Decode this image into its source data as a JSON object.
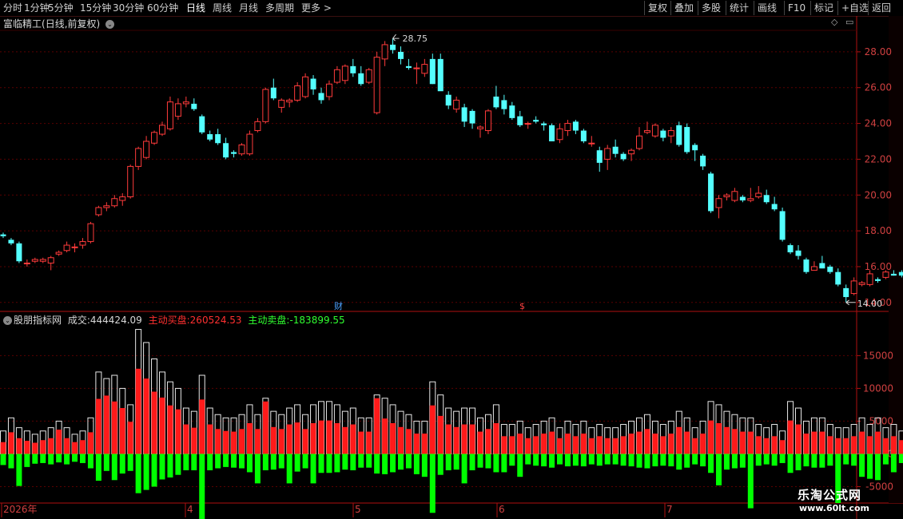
{
  "toolbar": {
    "left_items": [
      {
        "name": "toolbar-fenshi",
        "label": "分时"
      },
      {
        "name": "toolbar-1min",
        "label": "1分钟"
      },
      {
        "name": "toolbar-5min",
        "label": "5分钟"
      },
      {
        "name": "toolbar-15min",
        "label": "15分钟"
      },
      {
        "name": "toolbar-30min",
        "label": "30分钟"
      },
      {
        "name": "toolbar-60min",
        "label": "60分钟"
      },
      {
        "name": "toolbar-daily",
        "label": "日线",
        "active": true
      },
      {
        "name": "toolbar-weekly",
        "label": "周线"
      },
      {
        "name": "toolbar-monthly",
        "label": "月线"
      },
      {
        "name": "toolbar-multi-period",
        "label": "多周期"
      },
      {
        "name": "toolbar-more",
        "label": "更多 >"
      }
    ],
    "right_items": [
      {
        "name": "toolbar-fuquan",
        "label": "复权"
      },
      {
        "name": "toolbar-diejia",
        "label": "叠加"
      },
      {
        "name": "toolbar-duogu",
        "label": "多股"
      },
      {
        "name": "toolbar-tongji",
        "label": "统计"
      },
      {
        "name": "toolbar-huaxian",
        "label": "画线"
      },
      {
        "name": "toolbar-f10",
        "label": "F10"
      },
      {
        "name": "toolbar-biaoji",
        "label": "标记"
      },
      {
        "name": "toolbar-add-watch",
        "label": "+自选"
      },
      {
        "name": "toolbar-back",
        "label": "返回"
      }
    ]
  },
  "main_header": {
    "stock_name": "富临精工",
    "mode": "(日线,前复权)"
  },
  "indicator_header": {
    "name": "股朋指标网",
    "vol_label": "成交:",
    "vol_value": "444424.09",
    "buy_label": "主动买盘:",
    "buy_value": "260524.53",
    "sell_label": "主动卖盘:",
    "sell_value": "-183899.55"
  },
  "markers": {
    "cai": "财",
    "dollar": "$",
    "high_label": "28.75",
    "low_label": "14.00"
  },
  "price_axis": [
    "28.00",
    "26.00",
    "24.00",
    "22.00",
    "20.00",
    "18.00",
    "16.00",
    "14.00"
  ],
  "volume_axis": [
    "15000",
    "10000",
    "5000",
    "0",
    "-5000"
  ],
  "date_axis": [
    "2026年",
    "4",
    "5",
    "6",
    "7"
  ],
  "logo": {
    "line1": "乐淘公式网",
    "line2": "www.60lt.com"
  },
  "colors": {
    "up": "#ff3b3b",
    "down": "#54ffff",
    "buy": "#ff1a1a",
    "sell": "#00ff00",
    "bg": "#000000",
    "grid": "#5a0000"
  },
  "chart_data": [
    {
      "type": "candlestick",
      "title": "富临精工(日线,前复权)",
      "ylim": [
        13.5,
        29.2
      ],
      "ohlc": [
        [
          17.8,
          17.9,
          17.6,
          17.7
        ],
        [
          17.5,
          17.6,
          17.2,
          17.3
        ],
        [
          17.3,
          17.4,
          16.2,
          16.3
        ],
        [
          16.2,
          16.4,
          16.0,
          16.2
        ],
        [
          16.3,
          16.5,
          16.2,
          16.4
        ],
        [
          16.3,
          16.5,
          16.2,
          16.4
        ],
        [
          16.2,
          16.6,
          15.8,
          16.5
        ],
        [
          16.7,
          16.9,
          16.6,
          16.8
        ],
        [
          16.9,
          17.4,
          16.8,
          17.2
        ],
        [
          17.1,
          17.3,
          16.8,
          17.1
        ],
        [
          17.2,
          17.6,
          17.0,
          17.4
        ],
        [
          17.4,
          18.5,
          17.3,
          18.4
        ],
        [
          18.9,
          19.4,
          18.8,
          19.3
        ],
        [
          19.3,
          19.6,
          19.1,
          19.4
        ],
        [
          19.4,
          20.0,
          19.3,
          19.8
        ],
        [
          19.7,
          20.1,
          19.4,
          19.9
        ],
        [
          19.9,
          21.7,
          19.8,
          21.6
        ],
        [
          21.6,
          22.7,
          21.4,
          22.6
        ],
        [
          22.1,
          23.3,
          22.0,
          23.0
        ],
        [
          22.9,
          23.6,
          22.8,
          23.5
        ],
        [
          23.4,
          24.1,
          23.3,
          23.9
        ],
        [
          23.7,
          25.5,
          23.6,
          25.2
        ],
        [
          24.4,
          25.4,
          24.2,
          25.1
        ],
        [
          25.1,
          25.5,
          24.9,
          25.2
        ],
        [
          25.1,
          25.4,
          24.7,
          24.8
        ],
        [
          24.4,
          24.5,
          23.4,
          23.5
        ],
        [
          23.4,
          23.6,
          23.0,
          23.1
        ],
        [
          23.4,
          23.7,
          22.8,
          22.9
        ],
        [
          22.9,
          23.2,
          22.0,
          22.1
        ],
        [
          22.4,
          22.5,
          22.1,
          22.3
        ],
        [
          22.3,
          22.9,
          22.2,
          22.8
        ],
        [
          22.3,
          23.6,
          22.2,
          23.4
        ],
        [
          23.6,
          24.3,
          23.5,
          24.1
        ],
        [
          24.1,
          26.0,
          24.0,
          25.9
        ],
        [
          26.0,
          26.5,
          25.3,
          25.4
        ],
        [
          24.9,
          25.4,
          24.6,
          25.3
        ],
        [
          25.2,
          25.4,
          24.9,
          25.3
        ],
        [
          25.3,
          26.3,
          25.2,
          26.1
        ],
        [
          25.5,
          26.8,
          25.4,
          26.6
        ],
        [
          26.5,
          26.7,
          25.6,
          25.9
        ],
        [
          25.7,
          26.0,
          25.1,
          25.3
        ],
        [
          25.5,
          26.4,
          25.3,
          26.2
        ],
        [
          26.3,
          27.2,
          26.2,
          27.0
        ],
        [
          26.4,
          27.3,
          26.2,
          27.2
        ],
        [
          27.2,
          27.6,
          26.6,
          26.8
        ],
        [
          26.8,
          27.2,
          26.1,
          26.2
        ],
        [
          26.3,
          27.1,
          26.2,
          27.0
        ],
        [
          24.6,
          28.0,
          24.5,
          27.7
        ],
        [
          27.6,
          28.6,
          27.2,
          28.4
        ],
        [
          28.4,
          28.75,
          27.9,
          28.1
        ],
        [
          28.0,
          28.3,
          27.3,
          27.6
        ],
        [
          27.2,
          27.6,
          27.0,
          27.1
        ],
        [
          27.1,
          27.4,
          26.2,
          27.1
        ],
        [
          26.8,
          27.6,
          26.6,
          27.3
        ],
        [
          27.6,
          27.9,
          26.2,
          26.2
        ],
        [
          27.6,
          27.9,
          26.0,
          25.8
        ],
        [
          25.6,
          25.8,
          24.8,
          25.0
        ],
        [
          24.8,
          25.5,
          24.6,
          25.3
        ],
        [
          24.9,
          25.1,
          23.8,
          24.1
        ],
        [
          24.7,
          24.8,
          23.7,
          24.0
        ],
        [
          23.7,
          23.9,
          23.2,
          23.8
        ],
        [
          23.6,
          24.8,
          23.4,
          24.7
        ],
        [
          25.5,
          26.1,
          24.8,
          24.9
        ],
        [
          25.3,
          25.6,
          24.5,
          24.8
        ],
        [
          25.0,
          25.2,
          24.2,
          24.3
        ],
        [
          24.4,
          24.7,
          23.8,
          23.9
        ],
        [
          24.0,
          24.1,
          23.7,
          24.0
        ],
        [
          24.2,
          24.4,
          24.0,
          24.1
        ],
        [
          24.0,
          24.1,
          23.6,
          23.9
        ],
        [
          23.9,
          24.0,
          23.0,
          23.0
        ],
        [
          23.1,
          24.0,
          22.9,
          23.7
        ],
        [
          23.6,
          24.2,
          23.3,
          24.0
        ],
        [
          24.1,
          24.2,
          23.4,
          23.6
        ],
        [
          23.6,
          23.7,
          22.9,
          23.0
        ],
        [
          22.9,
          23.3,
          22.7,
          22.9
        ],
        [
          22.5,
          22.7,
          21.3,
          21.8
        ],
        [
          22.0,
          22.8,
          21.4,
          22.6
        ],
        [
          22.7,
          23.1,
          22.1,
          22.3
        ],
        [
          22.3,
          22.4,
          21.9,
          22.0
        ],
        [
          22.3,
          22.6,
          21.9,
          22.5
        ],
        [
          22.6,
          23.8,
          22.5,
          23.3
        ],
        [
          23.5,
          24.1,
          23.4,
          23.6
        ],
        [
          23.3,
          24.0,
          23.2,
          23.9
        ],
        [
          23.6,
          23.7,
          23.0,
          23.2
        ],
        [
          23.3,
          23.8,
          22.9,
          23.6
        ],
        [
          23.9,
          24.1,
          22.7,
          22.8
        ],
        [
          23.8,
          24.0,
          22.3,
          22.4
        ],
        [
          22.8,
          22.9,
          21.9,
          22.5
        ],
        [
          22.2,
          22.3,
          21.4,
          21.6
        ],
        [
          21.2,
          21.3,
          19.0,
          19.1
        ],
        [
          19.3,
          20.0,
          18.7,
          19.8
        ],
        [
          19.9,
          20.1,
          19.7,
          20.0
        ],
        [
          19.7,
          20.4,
          19.6,
          20.2
        ],
        [
          19.9,
          20.0,
          19.6,
          19.7
        ],
        [
          19.7,
          20.4,
          19.6,
          19.8
        ],
        [
          19.9,
          20.5,
          19.8,
          20.1
        ],
        [
          20.0,
          20.3,
          19.5,
          19.6
        ],
        [
          19.5,
          19.9,
          19.1,
          19.2
        ],
        [
          19.1,
          19.3,
          17.4,
          17.5
        ],
        [
          17.2,
          17.3,
          16.7,
          16.8
        ],
        [
          16.9,
          17.2,
          16.4,
          16.6
        ],
        [
          16.4,
          16.5,
          15.6,
          15.7
        ],
        [
          15.8,
          16.3,
          15.8,
          16.0
        ],
        [
          16.2,
          16.6,
          15.9,
          15.9
        ],
        [
          16.0,
          16.1,
          15.6,
          15.7
        ],
        [
          15.7,
          15.9,
          14.9,
          15.0
        ],
        [
          14.8,
          15.0,
          14.0,
          14.3
        ],
        [
          14.5,
          15.4,
          14.4,
          15.2
        ],
        [
          15.0,
          15.2,
          14.9,
          15.1
        ],
        [
          15.0,
          15.8,
          14.9,
          15.6
        ],
        [
          15.3,
          15.4,
          15.1,
          15.2
        ],
        [
          15.4,
          15.8,
          15.3,
          15.7
        ],
        [
          15.6,
          15.8,
          15.5,
          15.5
        ],
        [
          15.7,
          15.8,
          15.4,
          15.5
        ],
        [
          15.4,
          15.9,
          14.8,
          15.7
        ]
      ]
    },
    {
      "type": "bar",
      "title": "股朋指标网",
      "ylim": [
        -7500,
        19800
      ],
      "series": [
        {
          "name": "成交",
          "values": [
            3500,
            5500,
            4000,
            3500,
            3000,
            3500,
            4000,
            5000,
            4000,
            3000,
            3500,
            5500,
            12500,
            11500,
            12000,
            10000,
            7500,
            19000,
            17000,
            14500,
            12500,
            11000,
            10000,
            7000,
            6500,
            12000,
            7000,
            6000,
            5500,
            5500,
            6000,
            7500,
            6000,
            8500,
            6500,
            6000,
            7000,
            7500,
            6000,
            7500,
            8000,
            8000,
            7500,
            6500,
            7000,
            5500,
            5500,
            9000,
            8500,
            7500,
            6500,
            6000,
            5000,
            5000,
            11000,
            9000,
            7000,
            6500,
            7000,
            7000,
            5500,
            6000,
            7500,
            4500,
            4500,
            5000,
            4000,
            4500,
            5000,
            5500,
            4000,
            5000,
            4500,
            5000,
            4000,
            4500,
            4000,
            4000,
            4500,
            5000,
            5500,
            6000,
            5000,
            4500,
            5000,
            6500,
            5500,
            4000,
            5000,
            8000,
            7500,
            6500,
            6000,
            5500,
            5500,
            4500,
            4000,
            4500,
            3500,
            8000,
            7000,
            5000,
            5500,
            5500,
            4500,
            4000,
            4000,
            4500,
            5500,
            4500,
            5500,
            4000,
            4500,
            3500,
            3500,
            4500
          ]
        },
        {
          "name": "主动买盘",
          "values": [
            1800,
            3300,
            2400,
            2000,
            1700,
            2100,
            2400,
            3700,
            2400,
            1800,
            2100,
            3300,
            8400,
            8900,
            8000,
            7000,
            4900,
            13000,
            11500,
            9500,
            8600,
            7400,
            6800,
            4500,
            4000,
            8300,
            4500,
            3800,
            3500,
            3400,
            3800,
            4700,
            3800,
            8000,
            4100,
            3800,
            4500,
            4800,
            3800,
            4700,
            5100,
            5100,
            4700,
            4100,
            4500,
            3400,
            3400,
            8500,
            5400,
            4700,
            4100,
            3800,
            3100,
            3100,
            7400,
            5800,
            4500,
            4100,
            4500,
            4500,
            3400,
            3800,
            4700,
            2700,
            2700,
            3100,
            2400,
            2700,
            3100,
            3400,
            2400,
            3100,
            2700,
            3100,
            2400,
            2700,
            2400,
            2400,
            2700,
            3100,
            3400,
            3800,
            3100,
            2700,
            3100,
            4100,
            3400,
            2400,
            3100,
            5100,
            4700,
            4100,
            3800,
            3400,
            3400,
            2700,
            2400,
            2700,
            2100,
            5100,
            4500,
            3100,
            3400,
            3400,
            2700,
            2400,
            2400,
            2700,
            3400,
            2700,
            3400,
            2400,
            2700,
            2100,
            2100,
            2700
          ]
        },
        {
          "name": "主动卖盘",
          "values": [
            -1700,
            -2200,
            -4900,
            -2000,
            -1500,
            -1400,
            -1600,
            -1300,
            -1600,
            -1200,
            -1400,
            -2200,
            -4100,
            -2600,
            -4000,
            -3000,
            -2600,
            -6000,
            -5500,
            -5000,
            -3900,
            -3600,
            -3200,
            -2500,
            -2500,
            -10500,
            -2500,
            -2200,
            -2000,
            -2100,
            -2200,
            -2800,
            -4500,
            -2500,
            -2400,
            -2200,
            -4500,
            -2700,
            -2200,
            -4500,
            -2900,
            -2900,
            -2800,
            -2400,
            -2500,
            -2100,
            -2100,
            -3000,
            -3100,
            -2800,
            -2400,
            -2200,
            -3100,
            -3500,
            -9000,
            -3200,
            -2500,
            -2400,
            -4500,
            -2500,
            -2100,
            -2200,
            -2800,
            -2800,
            -1800,
            -3500,
            -1600,
            -1800,
            -1900,
            -2100,
            -1600,
            -1900,
            -1800,
            -1900,
            -1600,
            -1800,
            -1600,
            -1600,
            -1800,
            -1900,
            -2100,
            -2200,
            -1900,
            -1800,
            -1900,
            -2400,
            -2100,
            -1600,
            -1900,
            -2900,
            -4800,
            -2400,
            -2200,
            -2100,
            -8300,
            -1800,
            -1600,
            -1800,
            -1400,
            -2900,
            -2500,
            -1900,
            -2100,
            -2100,
            -1800,
            -7500,
            -1600,
            -1800,
            -3500,
            -3800,
            -4000,
            -1600,
            -2800,
            -1400,
            -1400,
            -1800
          ]
        }
      ]
    }
  ]
}
